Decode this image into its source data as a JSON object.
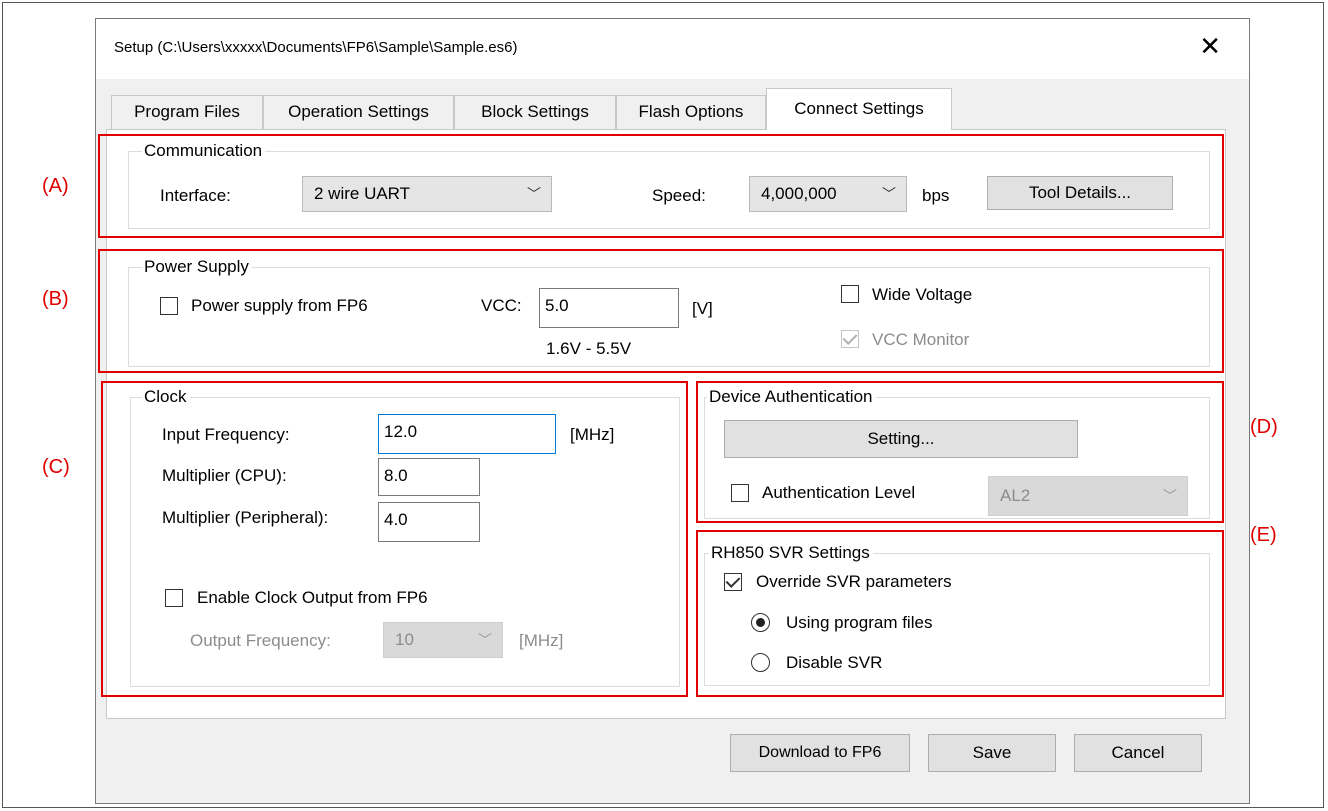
{
  "window": {
    "title": "Setup (C:\\Users\\xxxxx\\Documents\\FP6\\Sample\\Sample.es6)",
    "close_icon": "close-icon"
  },
  "tabs": [
    {
      "label": "Program Files",
      "active": false
    },
    {
      "label": "Operation Settings",
      "active": false
    },
    {
      "label": "Block Settings",
      "active": false
    },
    {
      "label": "Flash Options",
      "active": false
    },
    {
      "label": "Connect Settings",
      "active": true
    }
  ],
  "annotations": {
    "a": "(A)",
    "b": "(B)",
    "c": "(C)",
    "d": "(D)",
    "e": "(E)"
  },
  "communication": {
    "legend": "Communication",
    "interface_label": "Interface:",
    "interface_value": "2 wire UART",
    "speed_label": "Speed:",
    "speed_value": "4,000,000",
    "speed_unit": "bps",
    "tool_details_button": "Tool Details..."
  },
  "power_supply": {
    "legend": "Power Supply",
    "from_fp6_label": "Power supply from FP6",
    "from_fp6_checked": false,
    "vcc_label": "VCC:",
    "vcc_value": "5.0",
    "vcc_unit": "[V]",
    "vcc_range": "1.6V - 5.5V",
    "wide_voltage_label": "Wide Voltage",
    "wide_voltage_checked": false,
    "vcc_monitor_label": "VCC Monitor",
    "vcc_monitor_checked": true
  },
  "clock": {
    "legend": "Clock",
    "input_frequency_label": "Input Frequency:",
    "input_frequency_value": "12.0",
    "input_frequency_unit": "[MHz]",
    "multiplier_cpu_label": "Multiplier (CPU):",
    "multiplier_cpu_value": "8.0",
    "multiplier_peripheral_label": "Multiplier (Peripheral):",
    "multiplier_peripheral_value": "4.0",
    "enable_output_label": "Enable Clock Output from FP6",
    "enable_output_checked": false,
    "output_frequency_label": "Output Frequency:",
    "output_frequency_value": "10",
    "output_frequency_unit": "[MHz]"
  },
  "device_authentication": {
    "legend": "Device Authentication",
    "setting_button": "Setting...",
    "auth_level_label": "Authentication Level",
    "auth_level_checked": false,
    "auth_level_value": "AL2"
  },
  "svr": {
    "legend": "RH850 SVR Settings",
    "override_label": "Override SVR parameters",
    "override_checked": true,
    "using_program_files_label": "Using program files",
    "disable_svr_label": "Disable SVR",
    "selected": "Using program files"
  },
  "footer": {
    "download_button": "Download to FP6",
    "save_button": "Save",
    "cancel_button": "Cancel"
  }
}
